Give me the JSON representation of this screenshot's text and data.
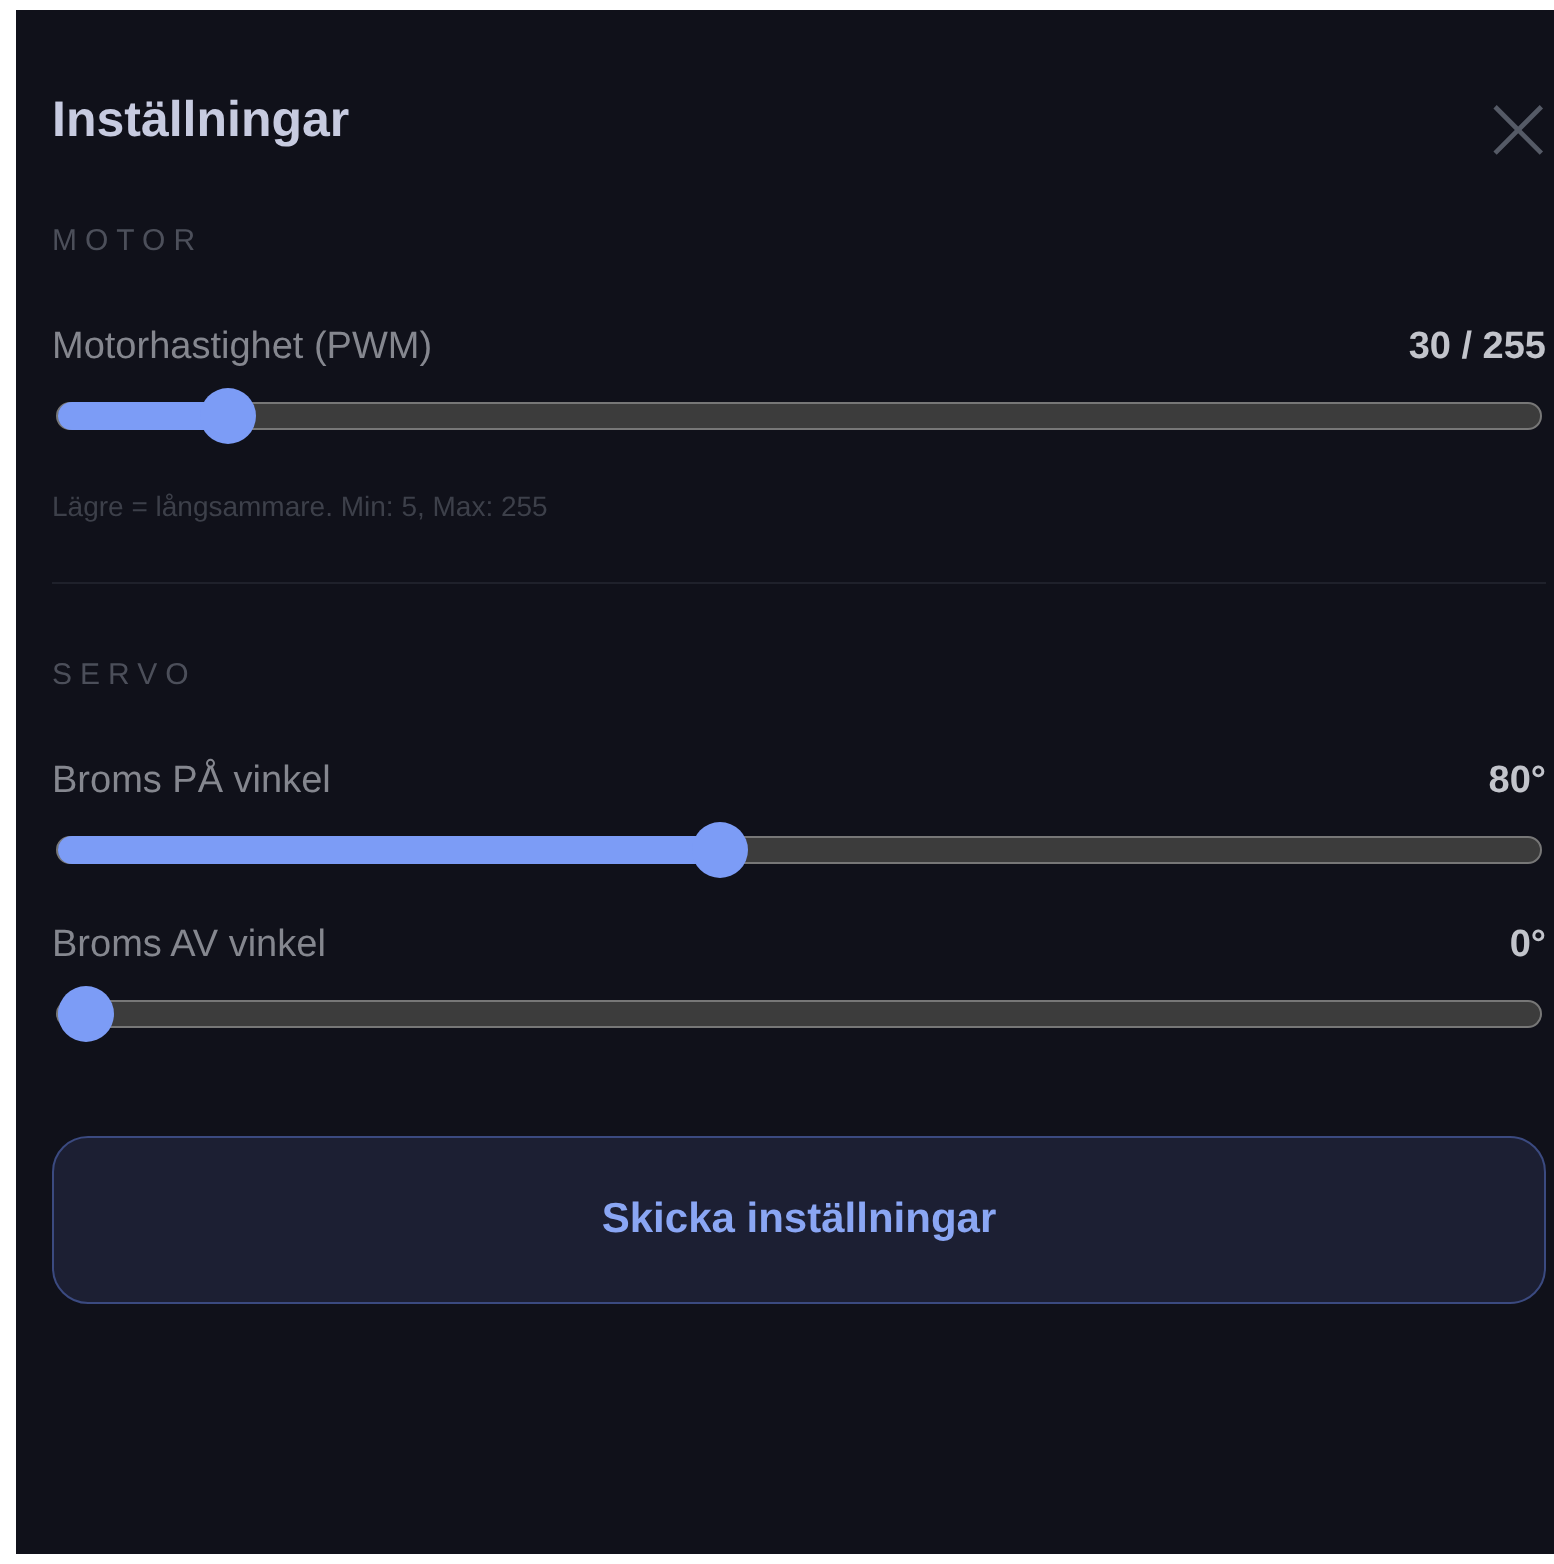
{
  "panel": {
    "title": "Inställningar",
    "close": "×"
  },
  "sections": [
    {
      "heading": "MOTOR",
      "sliders": [
        {
          "label": "Motorhastighet (PWM)",
          "reading": "30 / 255",
          "level": 0.1,
          "hint": "Lägre = långsammare. Min: 5, Max: 255"
        }
      ]
    },
    {
      "heading": "SERVO",
      "sliders": [
        {
          "label": "Broms PÅ vinkel",
          "reading": "80°",
          "level": 0.444
        },
        {
          "label": "Broms AV vinkel",
          "reading": "0°",
          "level": 0
        }
      ]
    }
  ],
  "submit": "Skicka inställningar"
}
